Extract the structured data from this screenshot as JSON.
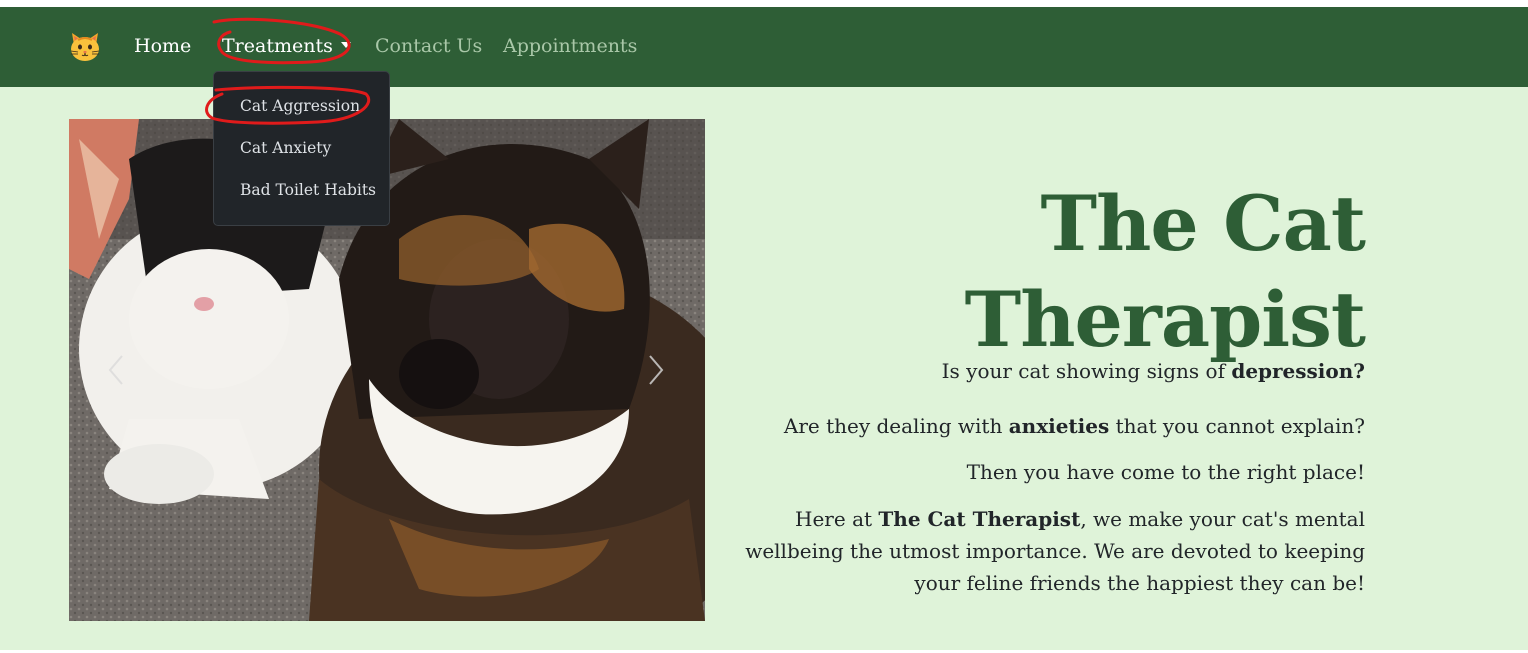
{
  "navbar": {
    "logo": "cat-face-icon",
    "links": {
      "home": "Home",
      "treatments": "Treatments",
      "contact": "Contact Us",
      "appointments": "Appointments"
    }
  },
  "dropdown": {
    "items": [
      "Cat Aggression",
      "Cat Anxiety",
      "Bad Toilet Habits"
    ]
  },
  "hero": {
    "title_line1": "The Cat",
    "title_line2": "Therapist",
    "p1_pre": "Is your cat showing signs of ",
    "p1_bold": "depression?",
    "p2_pre": "Are they dealing with ",
    "p2_bold": "anxieties",
    "p2_post": " that you cannot explain?",
    "p3": "Then you have come to the right place!",
    "p4_pre": "Here at ",
    "p4_bold": "The Cat Therapist",
    "p4_post": ", we make your cat's mental wellbeing the utmost importance. We are devoted to keeping your feline friends the happiest they can be!"
  },
  "carousel": {
    "prev_icon": "chevron-left-icon",
    "next_icon": "chevron-right-icon"
  },
  "colors": {
    "navbar": "#2e5e36",
    "page_bg": "#dff3d9",
    "title": "#2e5e36",
    "dropdown_bg": "#212529",
    "annotation": "#e01b1b"
  }
}
